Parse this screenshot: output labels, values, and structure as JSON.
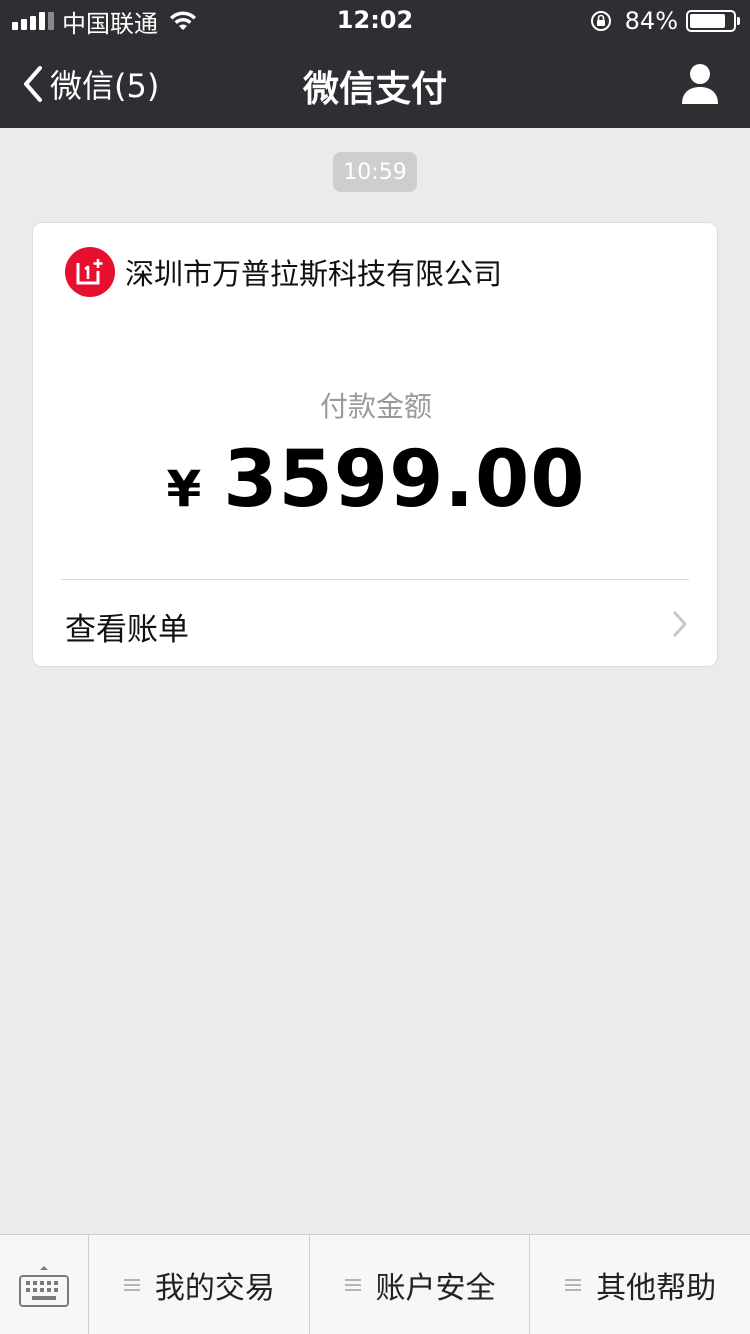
{
  "status_bar": {
    "carrier": "中国联通",
    "time": "12:02",
    "battery_percent": "84%",
    "battery_level": 0.84,
    "signal_bars": 4
  },
  "nav": {
    "back_label": "微信(5)",
    "title": "微信支付"
  },
  "chat": {
    "timestamp": "10:59"
  },
  "payment_card": {
    "merchant_name": "深圳市万普拉斯科技有限公司",
    "amount_label": "付款金额",
    "currency_symbol": "¥",
    "amount": "3599.00",
    "view_bill_label": "查看账单"
  },
  "bottom_menu": {
    "items": [
      {
        "label": "我的交易"
      },
      {
        "label": "账户安全"
      },
      {
        "label": "其他帮助"
      }
    ]
  },
  "colors": {
    "header_bg": "#2f2f33",
    "page_bg": "#ebebeb",
    "logo_red": "#e60f2e",
    "muted_text": "#9a9a9a"
  },
  "icons": [
    "wifi-icon",
    "rotation-lock-icon",
    "battery-icon",
    "back-chevron-icon",
    "user-icon",
    "merchant-logo-icon",
    "chevron-right-icon",
    "keyboard-icon",
    "menu-icon"
  ]
}
